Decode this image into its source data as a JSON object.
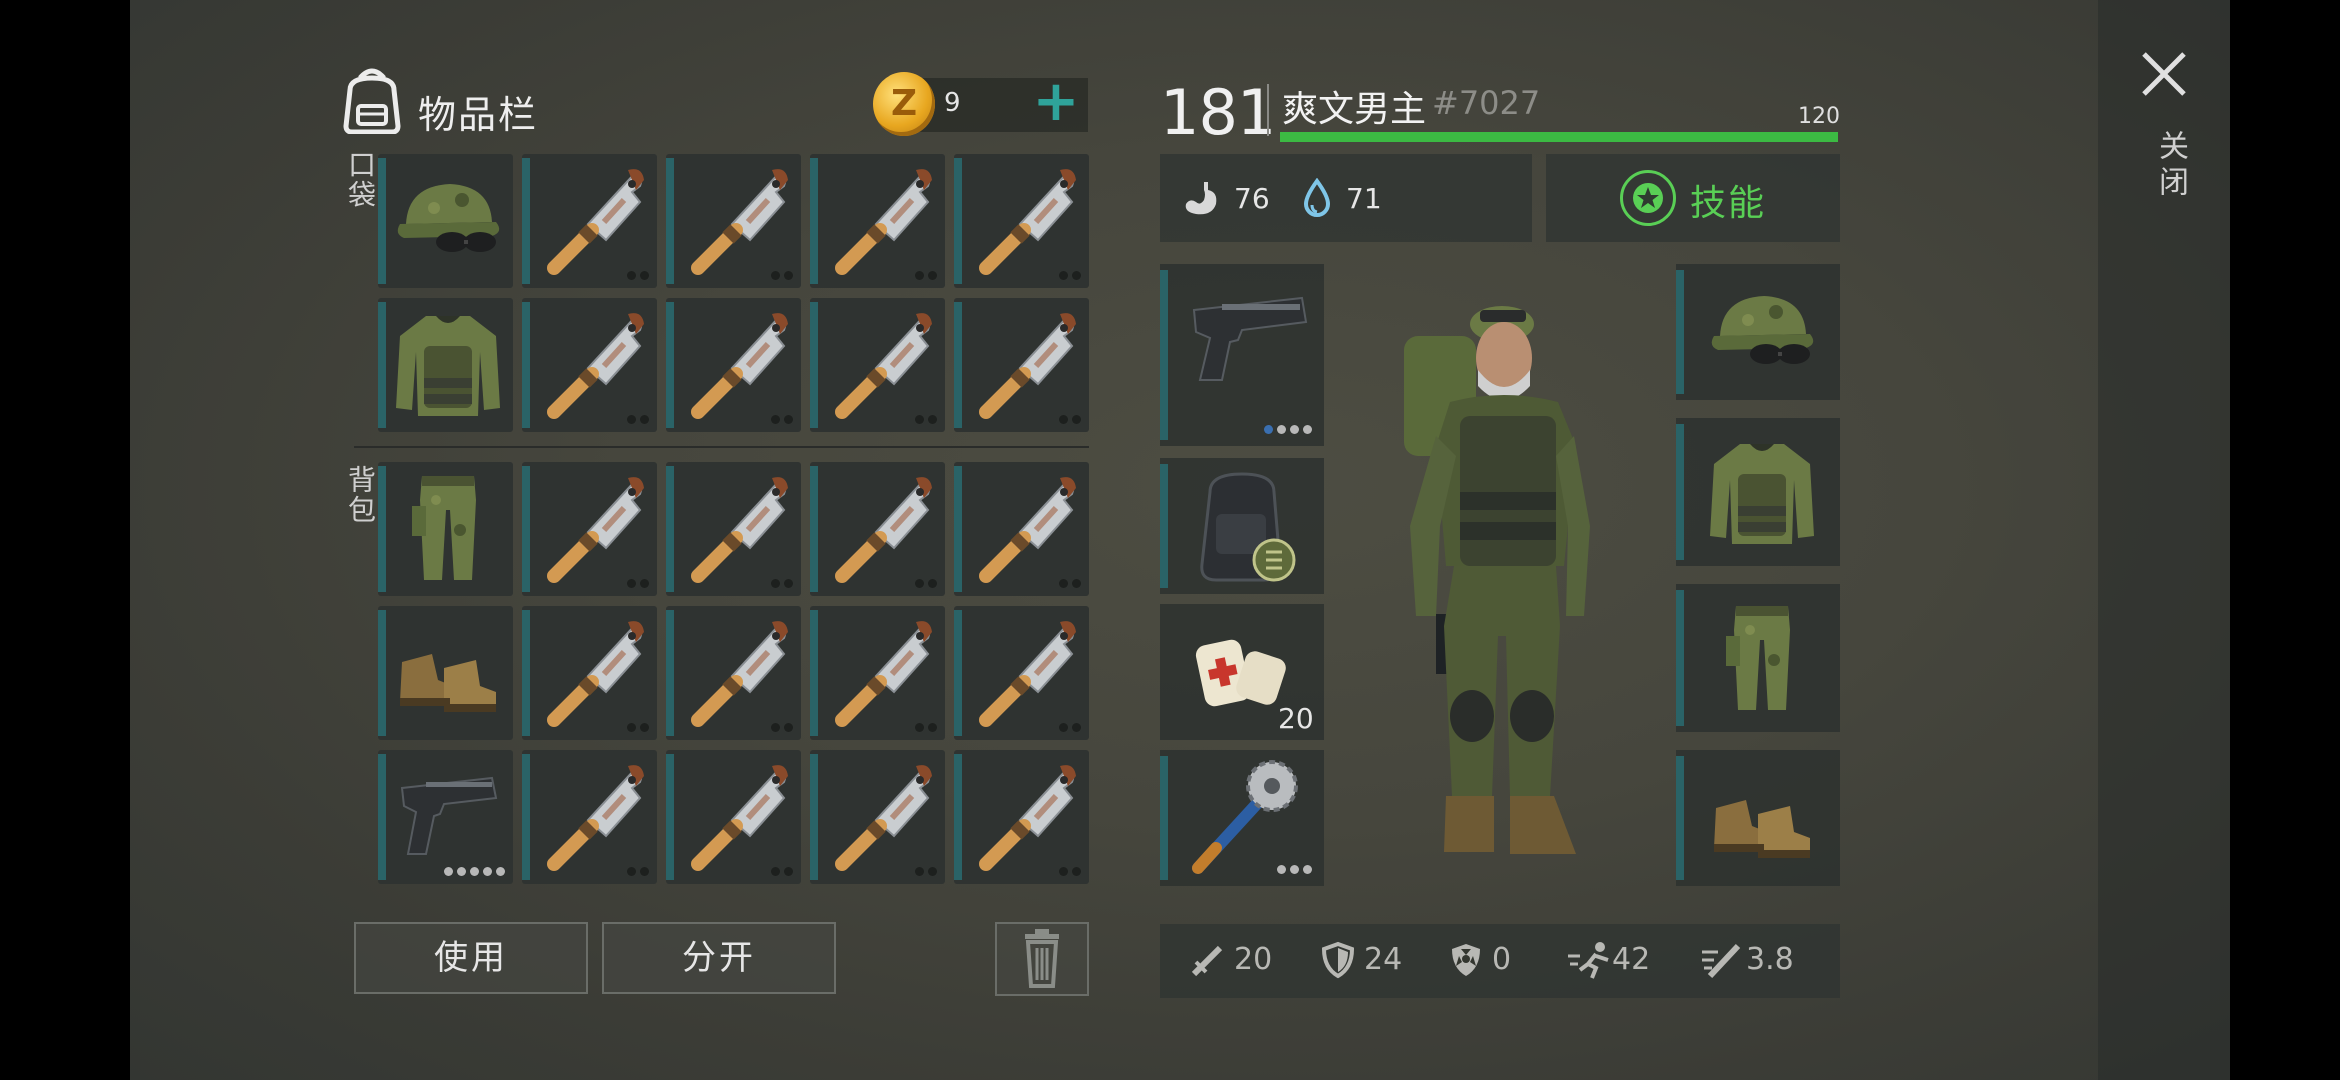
{
  "inventory": {
    "title": "物品栏",
    "coins": "9",
    "coin_symbol": "Z",
    "add_icon": "plus-icon",
    "pocket_label": "口袋",
    "backpack_label": "背包",
    "use_button": "使用",
    "split_button": "分开",
    "trash_icon": "trash-icon",
    "pocket_rows": [
      [
        "cap",
        "cleaver",
        "cleaver",
        "cleaver",
        "cleaver"
      ],
      [
        "jacket",
        "cleaver",
        "cleaver",
        "cleaver",
        "cleaver"
      ]
    ],
    "backpack_rows": [
      [
        "pants",
        "cleaver",
        "cleaver",
        "cleaver",
        "cleaver"
      ],
      [
        "boots",
        "cleaver",
        "cleaver",
        "cleaver",
        "cleaver"
      ],
      [
        "pistol",
        "cleaver",
        "cleaver",
        "cleaver",
        "cleaver"
      ]
    ]
  },
  "character": {
    "level": "181",
    "name": "爽文男主",
    "id": "#7027",
    "hp": "120",
    "hp_fraction": 1.0,
    "food": "76",
    "water": "71",
    "skills_label": "技能"
  },
  "equipment": {
    "left": [
      "pistol",
      "backpack",
      "bandage",
      "saw-mace"
    ],
    "bandage_count": "20",
    "right": [
      "cap",
      "jacket",
      "pants",
      "boots"
    ]
  },
  "stats": [
    {
      "icon": "sword-icon",
      "value": "20"
    },
    {
      "icon": "shield-icon",
      "value": "24"
    },
    {
      "icon": "radiation-icon",
      "value": "0"
    },
    {
      "icon": "run-icon",
      "value": "42"
    },
    {
      "icon": "speed-attack-icon",
      "value": "3.8"
    }
  ],
  "close_label": "关闭",
  "colors": {
    "accent": "#2fa39a",
    "hp": "#3cba43",
    "skill": "#59cf55",
    "slot_bar": "#2a6367"
  }
}
